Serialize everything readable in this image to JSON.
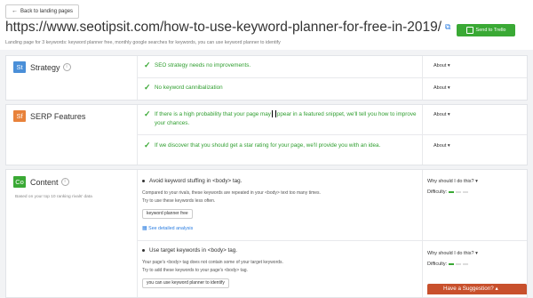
{
  "header": {
    "back_label": "Back to landing pages",
    "url": "https://www.seotipsit.com/how-to-use-keyword-planner-for-free-in-2019/",
    "send_label": "Send to Trello",
    "subtitle": "Landing page for 3 keywords: keyword planner free, monthly google searches for keywords, you can use keyword planner to identify"
  },
  "strategy": {
    "badge": "St",
    "label": "Strategy",
    "rows": [
      {
        "text": "SEO strategy needs no improvements.",
        "action": "About"
      },
      {
        "text": "No keyword cannibalization",
        "action": "About"
      }
    ]
  },
  "serp": {
    "badge": "Sf",
    "label": "SERP Features",
    "rows": [
      {
        "text_a": "If there is a high probability that your page may",
        "text_b": "ppear in a featured snippet, we'll tell you how to improve your chances.",
        "action": "About"
      },
      {
        "text": "If we discover that you should get a star rating for your page, we'll provide you with an idea.",
        "action": "About"
      }
    ]
  },
  "content": {
    "badge": "Co",
    "label": "Content",
    "sub": "Based on your top 10 ranking rivals' data",
    "items": [
      {
        "title": "Avoid keyword stuffing in <body> tag.",
        "desc1": "Compared to your rivals, these keywords are repeated in your <body> text too many times.",
        "desc2": "Try to use these keywords less often.",
        "tag": "keyword planner free",
        "link": "See detailed analysis",
        "why": "Why should I do this?",
        "difficulty": "Difficulty:"
      },
      {
        "title": "Use target keywords in <body> tag.",
        "desc1": "Your page's <body> tag does not contain some of your target keywords.",
        "desc2": "Try to add these keywords to your page's <body> tag.",
        "tag": "you can use keyword planner to identify",
        "why": "Why should I do this?",
        "difficulty": "Difficulty:"
      }
    ],
    "suggestion": "Have a Suggestion?"
  }
}
